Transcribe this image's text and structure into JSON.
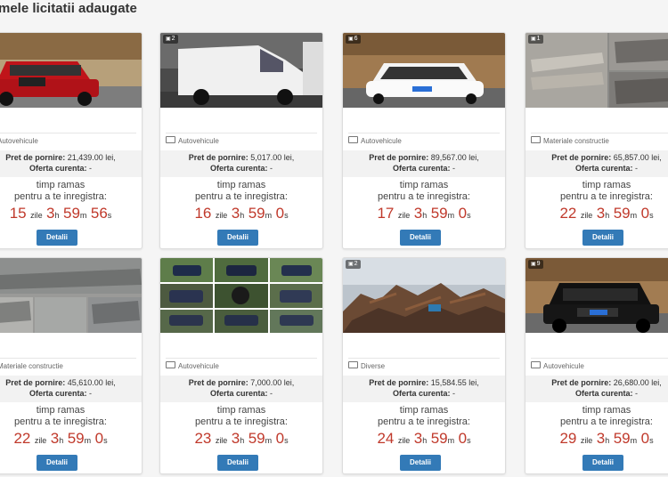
{
  "page_title": "mele licitatii adaugate",
  "labels": {
    "start_price": "Pret de pornire:",
    "current_offer": "Oferta curenta:",
    "time_left_line1": "timp ramas",
    "time_left_line2": "pentru a te inregistra:",
    "days_unit": "zile",
    "hours_unit": "h",
    "minutes_unit": "m",
    "seconds_unit": "s",
    "details_button": "Detalii"
  },
  "cards": [
    {
      "photo_count": "",
      "category": "Autovehicule",
      "start_price": "21,439.00 lei,",
      "current_offer": "-",
      "days": "15",
      "hours": "3",
      "minutes": "59",
      "seconds": "56",
      "image": "red-suv"
    },
    {
      "photo_count": "2",
      "category": "Autovehicule",
      "start_price": "5,017.00 lei,",
      "current_offer": "-",
      "days": "16",
      "hours": "3",
      "minutes": "59",
      "seconds": "0",
      "image": "white-van"
    },
    {
      "photo_count": "6",
      "category": "Autovehicule",
      "start_price": "89,567.00 lei,",
      "current_offer": "-",
      "days": "17",
      "hours": "3",
      "minutes": "59",
      "seconds": "0",
      "image": "white-sportscar"
    },
    {
      "photo_count": "1",
      "category": "Materiale constructie",
      "start_price": "65,857.00 lei,",
      "current_offer": "-",
      "days": "22",
      "hours": "3",
      "minutes": "59",
      "seconds": "0",
      "image": "materials"
    },
    {
      "photo_count": "",
      "category": "Materiale constructie",
      "start_price": "45,610.00 lei,",
      "current_offer": "-",
      "days": "22",
      "hours": "3",
      "minutes": "59",
      "seconds": "0",
      "image": "materials-grid"
    },
    {
      "photo_count": "",
      "category": "Autovehicule",
      "start_price": "7,000.00 lei,",
      "current_offer": "-",
      "days": "23",
      "hours": "3",
      "minutes": "59",
      "seconds": "0",
      "image": "car-grid"
    },
    {
      "photo_count": "2",
      "category": "Diverse",
      "start_price": "15,584.55 lei,",
      "current_offer": "-",
      "days": "24",
      "hours": "3",
      "minutes": "59",
      "seconds": "0",
      "image": "scrap"
    },
    {
      "photo_count": "9",
      "category": "Autovehicule",
      "start_price": "26,680.00 lei,",
      "current_offer": "-",
      "days": "29",
      "hours": "3",
      "minutes": "59",
      "seconds": "0",
      "image": "black-suv"
    }
  ]
}
